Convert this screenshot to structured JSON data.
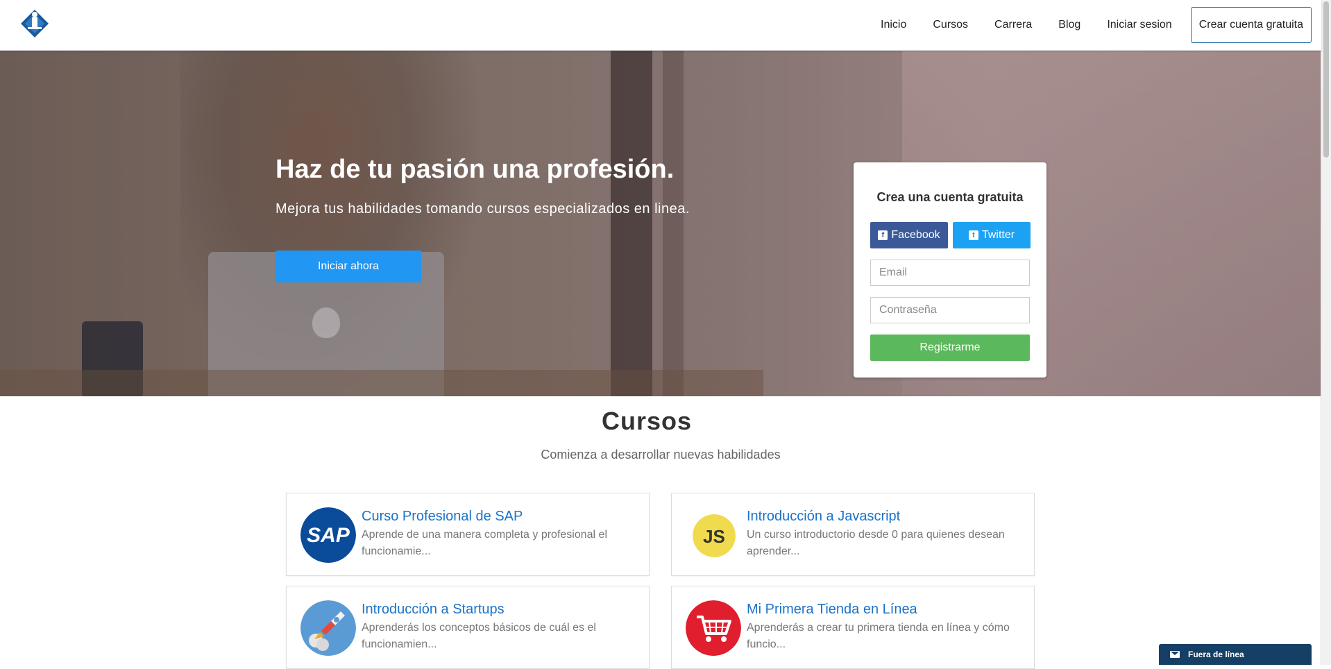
{
  "nav": {
    "links": [
      "Inicio",
      "Cursos",
      "Carrera",
      "Blog",
      "Iniciar sesion"
    ],
    "cta": "Crear cuenta gratuita"
  },
  "hero": {
    "title": "Haz de tu pasión una profesión.",
    "subtitle": "Mejora tus habilidades tomando cursos especializados en linea.",
    "button": "Iniciar ahora"
  },
  "signup": {
    "title": "Crea una cuenta gratuita",
    "facebook": "Facebook",
    "twitter": "Twitter",
    "email_placeholder": "Email",
    "password_placeholder": "Contraseña",
    "submit": "Registrarme"
  },
  "courses": {
    "title": "Cursos",
    "subtitle": "Comienza a desarrollar nuevas habilidades",
    "items": [
      {
        "title": "Curso Profesional de SAP",
        "desc": "Aprende de una manera completa y profesional el funcionamie...",
        "icon": "sap-logo-icon"
      },
      {
        "title": "Introducción a Javascript",
        "desc": "Un curso introductorio desde 0 para quienes desean aprender...",
        "icon": "js-logo-icon"
      },
      {
        "title": "Introducción a Startups",
        "desc": "Aprenderás los conceptos básicos de cuál es el funcionamien...",
        "icon": "rocket-icon"
      },
      {
        "title": "Mi Primera Tienda en Línea",
        "desc": "Aprenderás a crear tu primera tienda en línea y cómo funcio...",
        "icon": "shopping-cart-icon"
      }
    ]
  },
  "chat": {
    "label": "Fuera de línea",
    "icon": "envelope-icon"
  },
  "icon_labels": {
    "sap": "SAP",
    "js": "JS"
  },
  "colors": {
    "primary": "#2196f3",
    "facebook": "#3b5998",
    "twitter": "#1da1f2",
    "register": "#5cb85c",
    "link": "#1a73c8",
    "chat": "#163f66"
  }
}
